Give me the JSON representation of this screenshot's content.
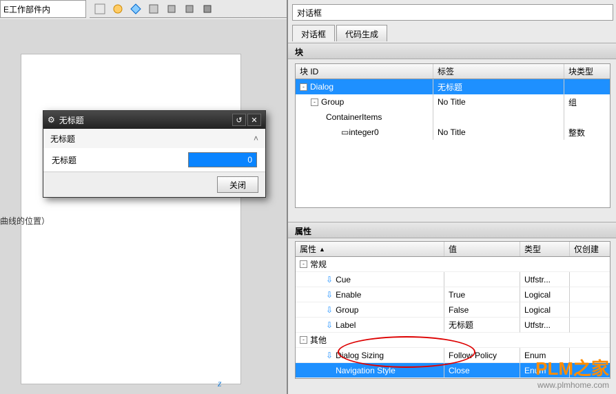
{
  "left": {
    "toolbar_label": "E工作部件内",
    "side_text": "曲线的位置）"
  },
  "dialog": {
    "title": "无标题",
    "group_label": "无标题",
    "field_label": "无标题",
    "field_value": "0",
    "close_btn": "关闭"
  },
  "right": {
    "search_value": "对话框",
    "tabs": {
      "t1": "对话框",
      "t2": "代码生成"
    },
    "blocks": {
      "title": "块",
      "headers": {
        "id": "块 ID",
        "label": "标签",
        "type": "块类型"
      },
      "rows": [
        {
          "id": "Dialog",
          "label": "无标题",
          "type": "",
          "indent": 0,
          "toggle": "-",
          "selected": true
        },
        {
          "id": "Group",
          "label": "No Title",
          "type": "组",
          "indent": 1,
          "toggle": "-",
          "selected": false
        },
        {
          "id": "ContainerItems",
          "label": "",
          "type": "",
          "indent": 2,
          "toggle": "",
          "selected": false
        },
        {
          "id": "integer0",
          "label": "No Title",
          "type": "整数",
          "indent": 3,
          "toggle": "",
          "selected": false
        }
      ]
    },
    "props": {
      "title": "属性",
      "headers": {
        "name": "属性",
        "val": "值",
        "type": "类型",
        "init": "仅创建"
      },
      "groups": [
        {
          "name": "常规",
          "rows": [
            {
              "name": "Cue",
              "val": "",
              "type": "Utfstr..."
            },
            {
              "name": "Enable",
              "val": "True",
              "type": "Logical"
            },
            {
              "name": "Group",
              "val": "False",
              "type": "Logical"
            },
            {
              "name": "Label",
              "val": "无标题",
              "type": "Utfstr..."
            }
          ]
        },
        {
          "name": "其他",
          "rows": [
            {
              "name": "Dialog Sizing",
              "val": "Follow Policy",
              "type": "Enum"
            },
            {
              "name": "Navigation Style",
              "val": "Close",
              "type": "Enum",
              "selected": true
            }
          ]
        }
      ]
    }
  },
  "watermark": {
    "big": "PLM之家",
    "small": "www.plmhome.com"
  },
  "axis_label": "z"
}
